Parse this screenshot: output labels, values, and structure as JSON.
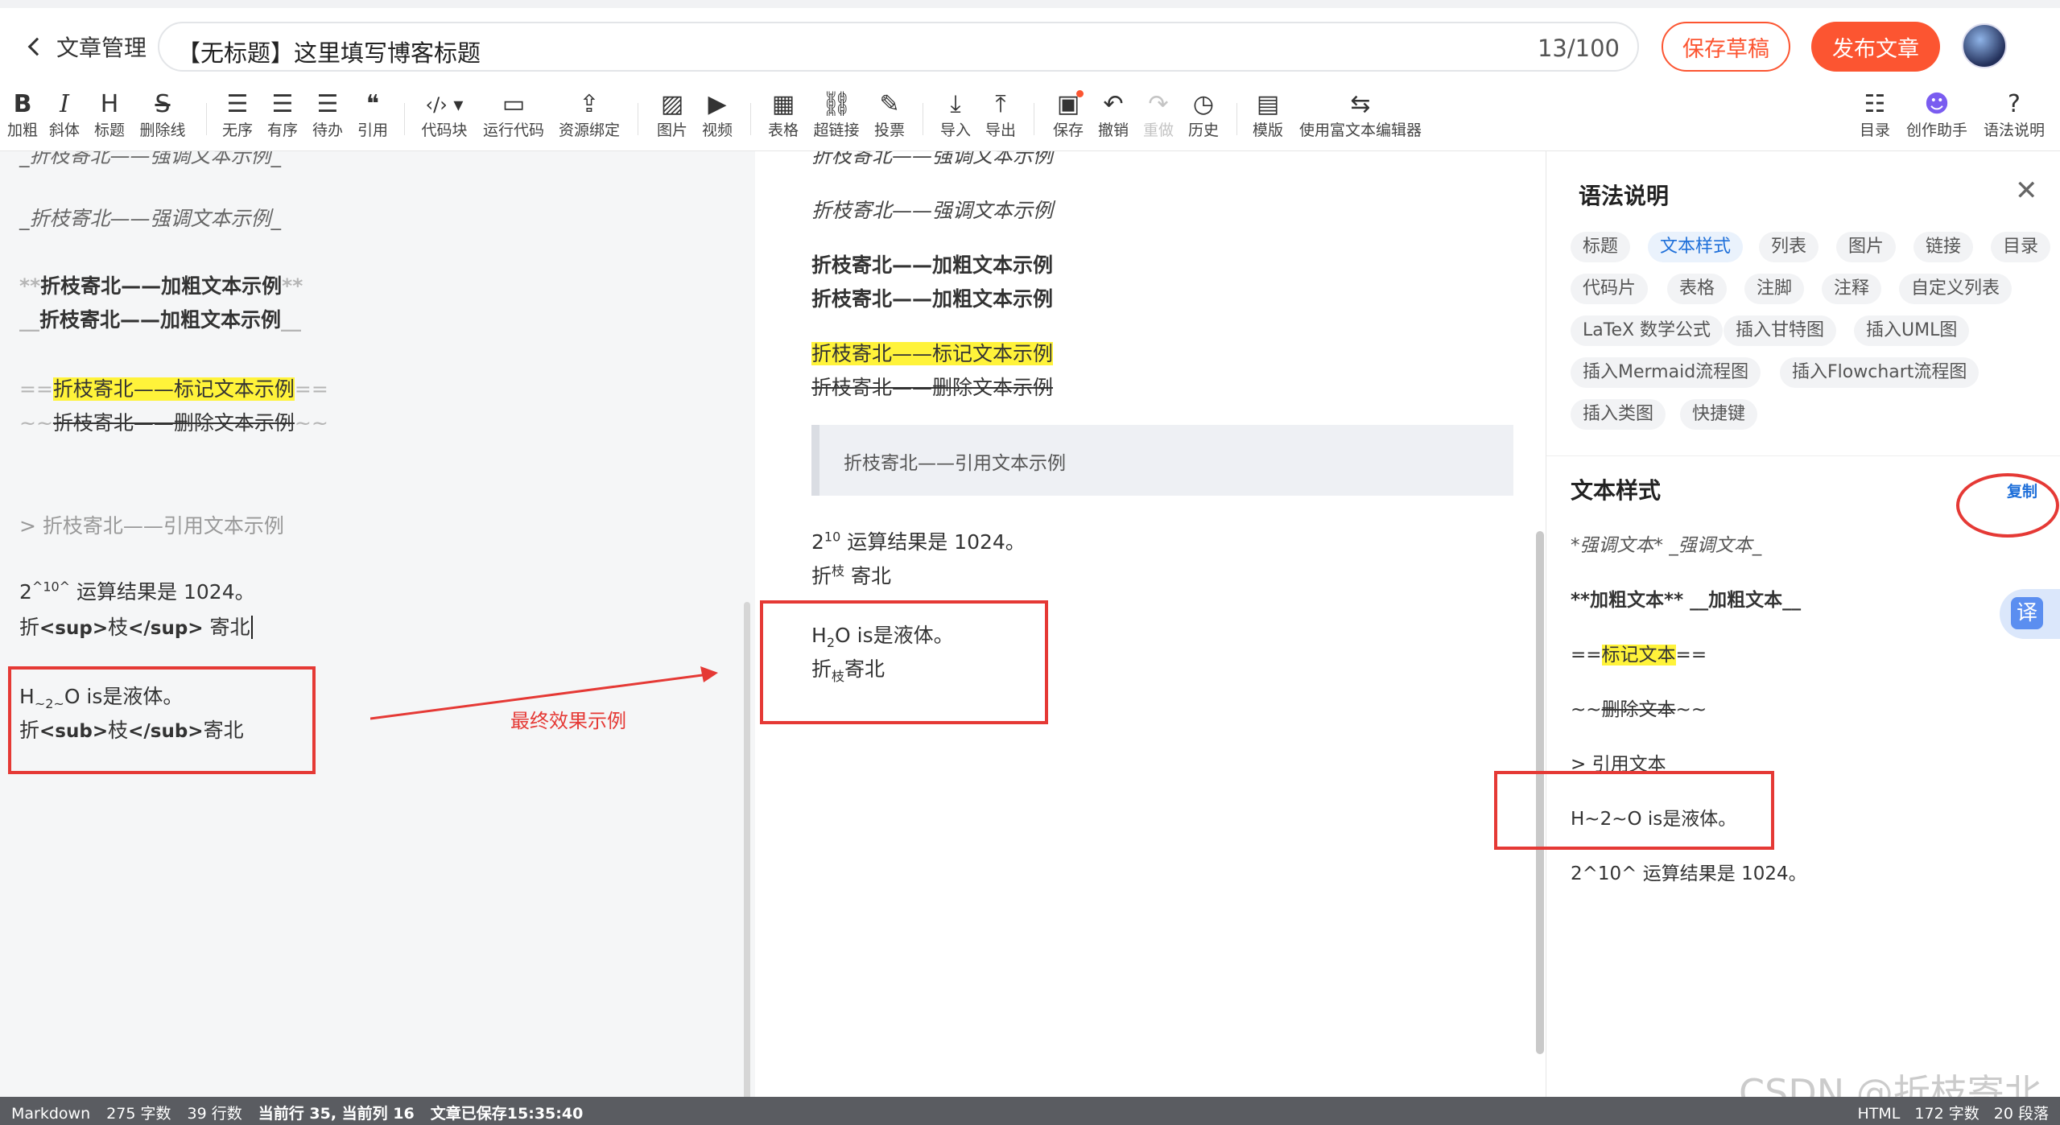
{
  "header": {
    "back_label": "文章管理",
    "title_value": "【无标题】这里填写博客标题",
    "title_count": "13/100",
    "save_draft": "保存草稿",
    "publish": "发布文章"
  },
  "toolbar": {
    "bold": {
      "icon": "B",
      "label": "加粗"
    },
    "italic": {
      "icon": "I",
      "label": "斜体"
    },
    "heading": {
      "icon": "H",
      "label": "标题"
    },
    "strike": {
      "icon": "S",
      "label": "删除线"
    },
    "ul": {
      "icon": "☰",
      "label": "无序"
    },
    "ol": {
      "icon": "☰",
      "label": "有序"
    },
    "todo": {
      "icon": "☰",
      "label": "待办"
    },
    "quote": {
      "icon": "❝",
      "label": "引用"
    },
    "code": {
      "icon": "‹/› ▾",
      "label": "代码块"
    },
    "run": {
      "icon": "▭",
      "label": "运行代码"
    },
    "resource": {
      "icon": "⇪",
      "label": "资源绑定"
    },
    "image": {
      "icon": "▨",
      "label": "图片"
    },
    "video": {
      "icon": "▶",
      "label": "视频"
    },
    "table": {
      "icon": "▦",
      "label": "表格"
    },
    "link": {
      "icon": "⛓",
      "label": "超链接"
    },
    "vote": {
      "icon": "✎",
      "label": "投票"
    },
    "import": {
      "icon": "⤓",
      "label": "导入"
    },
    "export": {
      "icon": "⤒",
      "label": "导出"
    },
    "save": {
      "icon": "▣",
      "label": "保存"
    },
    "undo": {
      "icon": "↶",
      "label": "撤销"
    },
    "redo": {
      "icon": "↷",
      "label": "重做"
    },
    "history": {
      "icon": "◷",
      "label": "历史"
    },
    "template": {
      "icon": "▤",
      "label": "模版"
    },
    "richtext": {
      "icon": "⇆",
      "label": "使用富文本编辑器"
    },
    "toc": {
      "icon": "☷",
      "label": "目录"
    },
    "assistant": {
      "icon": "☻",
      "label": "创作助手"
    },
    "syntax": {
      "icon": "?",
      "label": "语法说明"
    }
  },
  "editor": {
    "l0": "_折枝寄北——强调文本示例_",
    "l1": "_折枝寄北——强调文本示例_",
    "l2_mk": "**",
    "l2_txt": "折枝寄北——加粗文本示例",
    "l3_mk": "__",
    "l3_txt": "折枝寄北——加粗文本示例",
    "l4_mk": "==",
    "l4_txt": "折枝寄北——标记文本示例",
    "l5_mk": "~~",
    "l5_txt": "折枝寄北——删除文本示例",
    "l6": "> 折枝寄北——引用文本示例",
    "l7_a": "2",
    "l7_sup": "^10^",
    "l7_b": " 运算结果是 1024。",
    "l8_a": "折",
    "l8_tag1": "<sup>",
    "l8_mid": "枝",
    "l8_tag2": "</sup>",
    "l8_b": " 寄北",
    "l9_a": "H",
    "l9_sub": "~2~",
    "l9_b": "O is是液体。",
    "l10_a": "折",
    "l10_tag1": "<sub>",
    "l10_mid": "枝",
    "l10_tag2": "</sub>",
    "l10_b": "寄北",
    "annotation": "最终效果示例"
  },
  "preview": {
    "p0": "折枝寄北——强调文本示例",
    "p1": "折枝寄北——强调文本示例",
    "p2": "折枝寄北——加粗文本示例",
    "p3": "折枝寄北——加粗文本示例",
    "p4": "折枝寄北——标记文本示例",
    "p5": "折枝寄北——删除文本示例",
    "quote": "折枝寄北——引用文本示例",
    "p7_a": "2",
    "p7_sup": "10",
    "p7_b": " 运算结果是 1024。",
    "p8_a": "折",
    "p8_sup": "枝",
    "p8_b": " 寄北",
    "p9_a": "H",
    "p9_sub": "2",
    "p9_b": "O is是液体。",
    "p10_a": "折",
    "p10_sub": "枝",
    "p10_b": "寄北"
  },
  "panel": {
    "title": "语法说明",
    "chips": [
      "标题",
      "文本样式",
      "列表",
      "图片",
      "链接",
      "目录",
      "代码片",
      "表格",
      "注脚",
      "注释",
      "自定义列表",
      "LaTeX 数学公式",
      "插入甘特图",
      "插入UML图",
      "插入Mermaid流程图",
      "插入Flowchart流程图",
      "插入类图",
      "快捷键"
    ],
    "section_title": "文本样式",
    "copy": "复制",
    "e1": "*强调文本* _强调文本_",
    "e2": "**加粗文本** __加粗文本__",
    "e3_a": "==",
    "e3_hl": "标记文本",
    "e3_b": "==",
    "e4_a": "~~",
    "e4_del": "删除文本",
    "e4_b": "~~",
    "e5": "> 引用文本",
    "e6": "H~2~O is是液体。",
    "e7": "2^10^ 运算结果是 1024。",
    "translate": "译"
  },
  "status": {
    "mode": "Markdown",
    "words": "275 字数",
    "lines": "39 行数",
    "cursor": "当前行 35, 当前列 16",
    "saved": "文章已保存15:35:40",
    "html": "HTML",
    "html_words": "172 字数",
    "paragraphs": "20 段落"
  },
  "watermark": "CSDN @折枝寄北",
  "colors": {
    "accent": "#fc5531",
    "link": "#1e6fd9",
    "annotation": "#e53935",
    "highlight": "#fff33a",
    "status_bg": "#5a5c61"
  }
}
